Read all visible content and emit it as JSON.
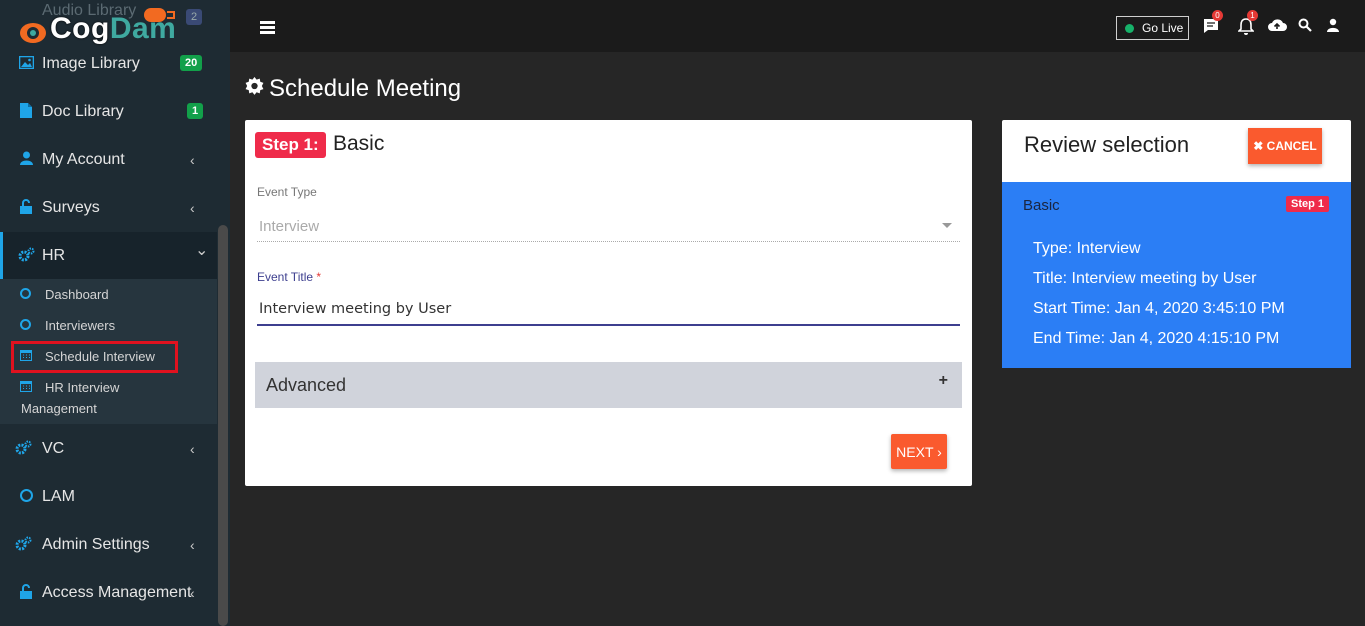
{
  "brand": {
    "logo_part1": "Cog",
    "logo_part2": "Dam",
    "ghost_item": "Audio Library",
    "ghost_badge": "2"
  },
  "sidebar": {
    "items": [
      {
        "label": "Image Library",
        "badge": "20",
        "icon": "image-icon"
      },
      {
        "label": "Doc Library",
        "badge": "1",
        "icon": "file-icon"
      },
      {
        "label": "My Account",
        "chevron": "‹",
        "icon": "user-icon"
      },
      {
        "label": "Surveys",
        "chevron": "‹",
        "icon": "lock-icon"
      },
      {
        "label": "HR",
        "chevron": "⌄",
        "icon": "cogs-icon"
      },
      {
        "label": "VC",
        "chevron": "‹",
        "icon": "cogs-icon"
      },
      {
        "label": "LAM",
        "icon": "circle-icon"
      },
      {
        "label": "Admin Settings",
        "chevron": "‹",
        "icon": "cogs-icon"
      },
      {
        "label": "Access Management",
        "chevron": "‹",
        "icon": "lock-icon"
      }
    ],
    "hr_submenu": [
      {
        "label": "Dashboard",
        "icon": "circle-icon"
      },
      {
        "label": "Interviewers",
        "icon": "circle-icon"
      },
      {
        "label": "Schedule Interview",
        "icon": "calendar-icon"
      },
      {
        "label": "HR Interview",
        "label2": "Management",
        "icon": "calendar-icon"
      }
    ]
  },
  "topbar": {
    "go_live": "Go Live",
    "chat_badge": "0",
    "bell_badge": "1"
  },
  "page": {
    "title": "Schedule Meeting"
  },
  "form": {
    "step_badge": "Step 1:",
    "step_title": "Basic",
    "event_type_label": "Event Type",
    "event_type_value": "Interview",
    "event_title_label": "Event Title",
    "event_title_required": "*",
    "event_title_value": "Interview meeting by User",
    "advanced_label": "Advanced",
    "advanced_toggle": "+",
    "next_label": "NEXT ›"
  },
  "review": {
    "title": "Review selection",
    "cancel_label": "✖ CANCEL",
    "section": "Basic",
    "step_tag": "Step 1",
    "lines": [
      "Type: Interview",
      "Title: Interview meeting by User",
      "Start Time: Jan 4, 2020 3:45:10 PM",
      "End Time: Jan 4, 2020 4:15:10 PM"
    ]
  },
  "colors": {
    "accent_orange": "#fa5a2e",
    "step_red": "#ef2b4a",
    "review_blue": "#2b7ef5",
    "sidebar_icon_blue": "#1fa5e8"
  }
}
